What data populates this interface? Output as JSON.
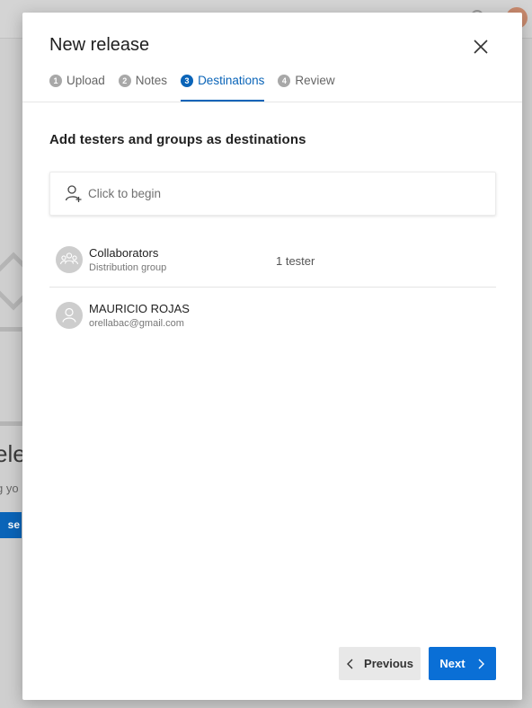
{
  "background": {
    "title_fragment": "ele",
    "subtitle_fragment": "g yo",
    "button_fragment": "se"
  },
  "dialog": {
    "title": "New release",
    "close_icon": "close-icon",
    "steps": [
      {
        "number": "1",
        "label": "Upload",
        "active": false
      },
      {
        "number": "2",
        "label": "Notes",
        "active": false
      },
      {
        "number": "3",
        "label": "Destinations",
        "active": true
      },
      {
        "number": "4",
        "label": "Review",
        "active": false
      }
    ],
    "heading": "Add testers and groups as destinations",
    "search": {
      "placeholder": "Click to begin",
      "icon": "add-person-icon"
    },
    "destinations": [
      {
        "name": "Collaborators",
        "subtitle": "Distribution group",
        "count": "1 tester",
        "icon": "group-icon"
      },
      {
        "name": "MAURICIO ROJAS",
        "subtitle": "orellabac@gmail.com",
        "count": "",
        "icon": "person-icon"
      }
    ],
    "previous_label": "Previous",
    "next_label": "Next"
  },
  "colors": {
    "accent": "#0a64b8",
    "next_button": "#0a6fd6",
    "previous_button": "#e8e8e8",
    "overlay": "#cfcfcf"
  }
}
